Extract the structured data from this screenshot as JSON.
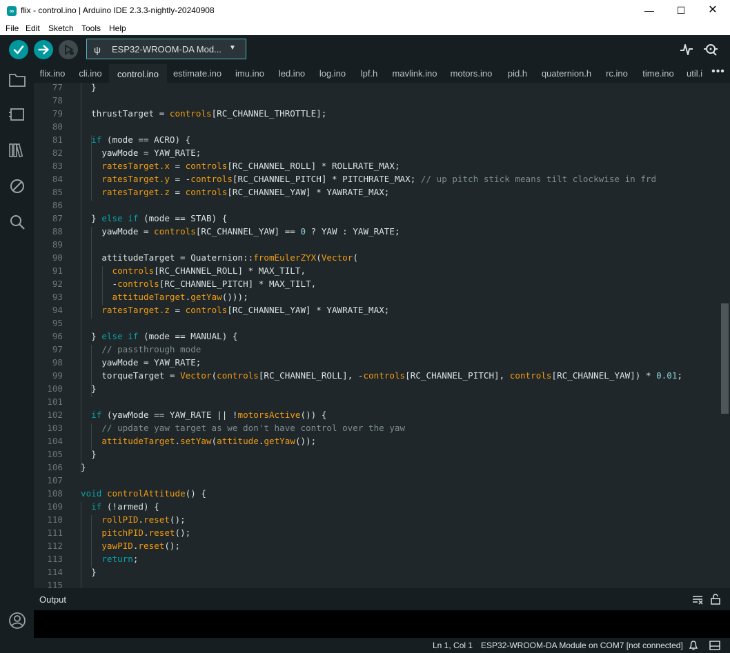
{
  "window": {
    "title": "flix - control.ino | Arduino IDE 2.3.3-nightly-20240908",
    "controls": {
      "minimize": "—",
      "maximize": "☐",
      "close": "✕"
    }
  },
  "menu": [
    "File",
    "Edit",
    "Sketch",
    "Tools",
    "Help"
  ],
  "toolbar": {
    "verify": "check-icon",
    "upload": "arrow-right-icon",
    "debug": "debug-icon",
    "board": "ESP32-WROOM-DA Mod...",
    "serial_plotter": "plotter-icon",
    "serial_monitor": "monitor-icon"
  },
  "sidebar": [
    "folder-icon",
    "board-icon",
    "library-icon",
    "debug-icon",
    "search-icon",
    "account-icon"
  ],
  "tabs": [
    {
      "label": "flix.ino"
    },
    {
      "label": "cli.ino"
    },
    {
      "label": "control.ino",
      "active": true
    },
    {
      "label": "estimate.ino"
    },
    {
      "label": "imu.ino"
    },
    {
      "label": "led.ino"
    },
    {
      "label": "log.ino"
    },
    {
      "label": "lpf.h"
    },
    {
      "label": "mavlink.ino"
    },
    {
      "label": "motors.ino"
    },
    {
      "label": "pid.h"
    },
    {
      "label": "quaternion.h"
    },
    {
      "label": "rc.ino"
    },
    {
      "label": "time.ino"
    },
    {
      "label": "util.i"
    }
  ],
  "tabs_more": "•••",
  "editor": {
    "lines": [
      {
        "n": "77",
        "t": [
          [
            "",
            "  }"
          ]
        ]
      },
      {
        "n": "78",
        "t": []
      },
      {
        "n": "79",
        "t": [
          [
            "",
            "  thrustTarget = "
          ],
          [
            "fn",
            "controls"
          ],
          [
            "",
            "[RC_CHANNEL_THROTTLE];"
          ]
        ]
      },
      {
        "n": "80",
        "t": []
      },
      {
        "n": "81",
        "t": [
          [
            "kw",
            "  if"
          ],
          [
            "",
            " (mode == ACRO) {"
          ]
        ]
      },
      {
        "n": "82",
        "t": [
          [
            "",
            "    yawMode = YAW_RATE;"
          ]
        ]
      },
      {
        "n": "83",
        "t": [
          [
            "fn",
            "    ratesTarget.x"
          ],
          [
            "",
            " = "
          ],
          [
            "fn",
            "controls"
          ],
          [
            "",
            "[RC_CHANNEL_ROLL] * ROLLRATE_MAX;"
          ]
        ]
      },
      {
        "n": "84",
        "t": [
          [
            "fn",
            "    ratesTarget.y"
          ],
          [
            "",
            " = -"
          ],
          [
            "fn",
            "controls"
          ],
          [
            "",
            "[RC_CHANNEL_PITCH] * PITCHRATE_MAX; "
          ],
          [
            "cm",
            "// up pitch stick means tilt clockwise in frd"
          ]
        ]
      },
      {
        "n": "85",
        "t": [
          [
            "fn",
            "    ratesTarget.z"
          ],
          [
            "",
            " = "
          ],
          [
            "fn",
            "controls"
          ],
          [
            "",
            "[RC_CHANNEL_YAW] * YAWRATE_MAX;"
          ]
        ]
      },
      {
        "n": "86",
        "t": []
      },
      {
        "n": "87",
        "t": [
          [
            "",
            "  } "
          ],
          [
            "kw",
            "else if"
          ],
          [
            "",
            " (mode == STAB) {"
          ]
        ]
      },
      {
        "n": "88",
        "t": [
          [
            "",
            "    yawMode = "
          ],
          [
            "fn",
            "controls"
          ],
          [
            "",
            "[RC_CHANNEL_YAW] == "
          ],
          [
            "num",
            "0"
          ],
          [
            "",
            " ? YAW : YAW_RATE;"
          ]
        ]
      },
      {
        "n": "89",
        "t": []
      },
      {
        "n": "90",
        "t": [
          [
            "",
            "    attitudeTarget = Quaternion::"
          ],
          [
            "fn",
            "fromEulerZYX"
          ],
          [
            "",
            "("
          ],
          [
            "fn",
            "Vector"
          ],
          [
            "",
            "("
          ]
        ]
      },
      {
        "n": "91",
        "t": [
          [
            "fn",
            "      controls"
          ],
          [
            "",
            "[RC_CHANNEL_ROLL] * MAX_TILT,"
          ]
        ]
      },
      {
        "n": "92",
        "t": [
          [
            "",
            "      -"
          ],
          [
            "fn",
            "controls"
          ],
          [
            "",
            "[RC_CHANNEL_PITCH] * MAX_TILT,"
          ]
        ]
      },
      {
        "n": "93",
        "t": [
          [
            "fn",
            "      attitudeTarget"
          ],
          [
            "",
            "."
          ],
          [
            "fn",
            "getYaw"
          ],
          [
            "",
            "()));"
          ]
        ]
      },
      {
        "n": "94",
        "t": [
          [
            "fn",
            "    ratesTarget.z"
          ],
          [
            "",
            " = "
          ],
          [
            "fn",
            "controls"
          ],
          [
            "",
            "[RC_CHANNEL_YAW] * YAWRATE_MAX;"
          ]
        ]
      },
      {
        "n": "95",
        "t": []
      },
      {
        "n": "96",
        "t": [
          [
            "",
            "  } "
          ],
          [
            "kw",
            "else if"
          ],
          [
            "",
            " (mode == MANUAL) {"
          ]
        ]
      },
      {
        "n": "97",
        "t": [
          [
            "cm",
            "    // passthrough mode"
          ]
        ]
      },
      {
        "n": "98",
        "t": [
          [
            "",
            "    yawMode = YAW_RATE;"
          ]
        ]
      },
      {
        "n": "99",
        "t": [
          [
            "",
            "    torqueTarget = "
          ],
          [
            "fn",
            "Vector"
          ],
          [
            "",
            "("
          ],
          [
            "fn",
            "controls"
          ],
          [
            "",
            "[RC_CHANNEL_ROLL], -"
          ],
          [
            "fn",
            "controls"
          ],
          [
            "",
            "[RC_CHANNEL_PITCH], "
          ],
          [
            "fn",
            "controls"
          ],
          [
            "",
            "[RC_CHANNEL_YAW]) * "
          ],
          [
            "num",
            "0.01"
          ],
          [
            "",
            ";"
          ]
        ]
      },
      {
        "n": "100",
        "t": [
          [
            "",
            "  }"
          ]
        ]
      },
      {
        "n": "101",
        "t": []
      },
      {
        "n": "102",
        "t": [
          [
            "kw",
            "  if"
          ],
          [
            "",
            " (yawMode == YAW_RATE || !"
          ],
          [
            "fn",
            "motorsActive"
          ],
          [
            "",
            "()) {"
          ]
        ]
      },
      {
        "n": "103",
        "t": [
          [
            "cm",
            "    // update yaw target as we don't have control over the yaw"
          ]
        ]
      },
      {
        "n": "104",
        "t": [
          [
            "fn",
            "    attitudeTarget"
          ],
          [
            "",
            "."
          ],
          [
            "fn",
            "setYaw"
          ],
          [
            "",
            "("
          ],
          [
            "fn",
            "attitude"
          ],
          [
            "",
            "."
          ],
          [
            "fn",
            "getYaw"
          ],
          [
            "",
            "());"
          ]
        ]
      },
      {
        "n": "105",
        "t": [
          [
            "",
            "  }"
          ]
        ]
      },
      {
        "n": "106",
        "t": [
          [
            "",
            "}"
          ]
        ]
      },
      {
        "n": "107",
        "t": []
      },
      {
        "n": "108",
        "t": [
          [
            "kw",
            "void"
          ],
          [
            "",
            " "
          ],
          [
            "fn",
            "controlAttitude"
          ],
          [
            "",
            "() {"
          ]
        ]
      },
      {
        "n": "109",
        "t": [
          [
            "kw",
            "  if"
          ],
          [
            "",
            " (!armed) {"
          ]
        ]
      },
      {
        "n": "110",
        "t": [
          [
            "fn",
            "    rollPID"
          ],
          [
            "",
            "."
          ],
          [
            "fn",
            "reset"
          ],
          [
            "",
            "();"
          ]
        ]
      },
      {
        "n": "111",
        "t": [
          [
            "fn",
            "    pitchPID"
          ],
          [
            "",
            "."
          ],
          [
            "fn",
            "reset"
          ],
          [
            "",
            "();"
          ]
        ]
      },
      {
        "n": "112",
        "t": [
          [
            "fn",
            "    yawPID"
          ],
          [
            "",
            "."
          ],
          [
            "fn",
            "reset"
          ],
          [
            "",
            "();"
          ]
        ]
      },
      {
        "n": "113",
        "t": [
          [
            "kw",
            "    return"
          ],
          [
            "",
            ";"
          ]
        ]
      },
      {
        "n": "114",
        "t": [
          [
            "",
            "  }"
          ]
        ]
      },
      {
        "n": "115",
        "t": []
      }
    ]
  },
  "output": {
    "title": "Output"
  },
  "status": {
    "position": "Ln 1, Col 1",
    "board": "ESP32-WROOM-DA Module on COM7 [not connected]"
  }
}
